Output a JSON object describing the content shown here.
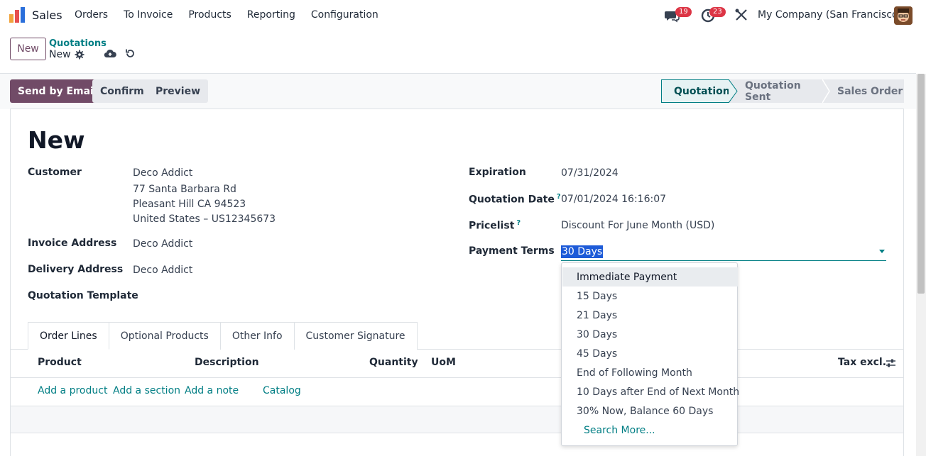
{
  "navbar": {
    "app_name": "Sales",
    "menu": [
      "Orders",
      "To Invoice",
      "Products",
      "Reporting",
      "Configuration"
    ],
    "messages_badge": "19",
    "activities_badge": "23",
    "company": "My Company (San Francisco)"
  },
  "control_panel": {
    "new_label": "New",
    "breadcrumb_parent": "Quotations",
    "breadcrumb_current": "New"
  },
  "statusbar": {
    "send_email": "Send by Email",
    "confirm": "Confirm",
    "preview": "Preview",
    "stages": [
      "Quotation",
      "Quotation Sent",
      "Sales Order"
    ],
    "active_stage": "Quotation"
  },
  "form": {
    "title": "New",
    "customer_label": "Customer",
    "customer_name": "Deco Addict",
    "customer_address": [
      "77 Santa Barbara Rd",
      "Pleasant Hill CA 94523",
      "United States – US12345673"
    ],
    "invoice_label": "Invoice Address",
    "invoice_value": "Deco Addict",
    "delivery_label": "Delivery Address",
    "delivery_value": "Deco Addict",
    "template_label": "Quotation Template",
    "expiration_label": "Expiration",
    "expiration_value": "07/31/2024",
    "quote_date_label": "Quotation Date",
    "quote_date_value": "07/01/2024 16:16:07",
    "pricelist_label": "Pricelist",
    "pricelist_value": "Discount For June Month (USD)",
    "terms_label": "Payment Terms",
    "terms_value": "30 Days",
    "help_mark": "?"
  },
  "tabs": [
    "Order Lines",
    "Optional Products",
    "Other Info",
    "Customer Signature"
  ],
  "table": {
    "headers": [
      "Product",
      "Description",
      "Quantity",
      "UoM",
      "Tax excl."
    ],
    "add_links": [
      "Add a product",
      "Add a section",
      "Add a note",
      "Catalog"
    ]
  },
  "dropdown": {
    "options": [
      "Immediate Payment",
      "15 Days",
      "21 Days",
      "30 Days",
      "45 Days",
      "End of Following Month",
      "10 Days after End of Next Month",
      "30% Now, Balance 60 Days"
    ],
    "search_more": "Search More..."
  },
  "colors": {
    "brand": "#714b67",
    "accent": "#017e84",
    "badge": "#dc3545"
  }
}
